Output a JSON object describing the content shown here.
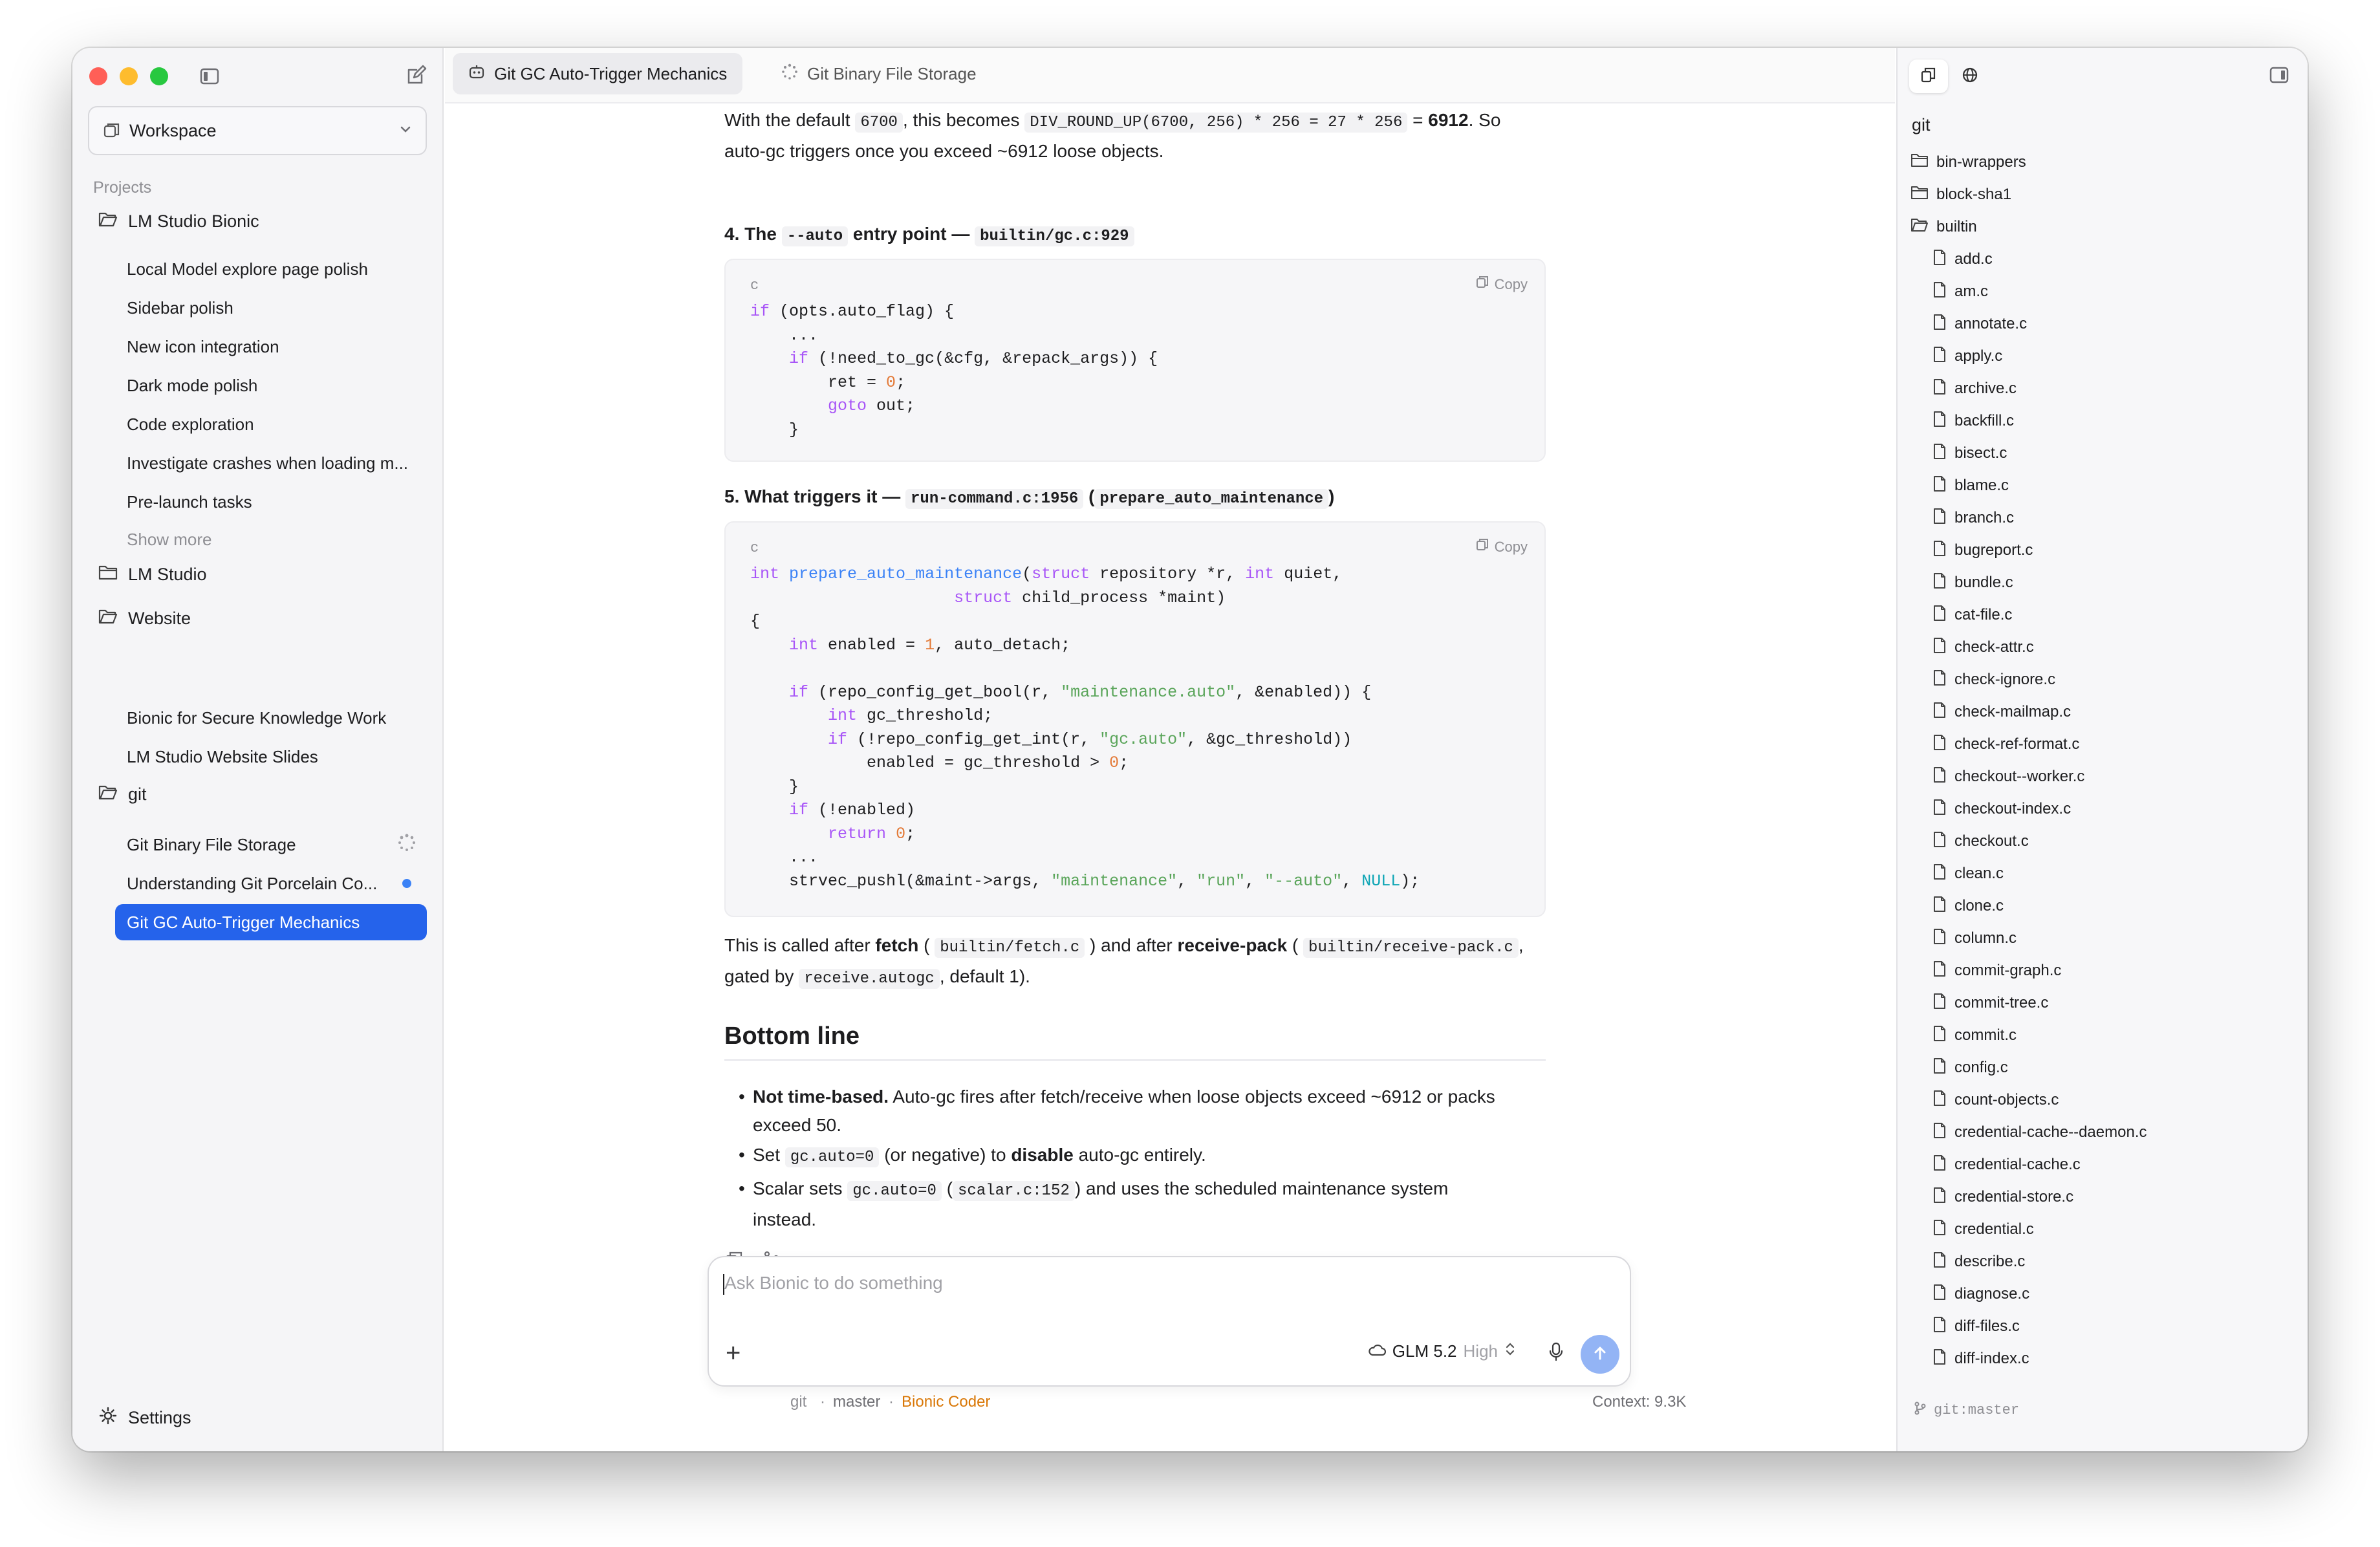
{
  "sidebar": {
    "workspace": "Workspace",
    "projects_label": "Projects",
    "projects": [
      {
        "name": "LM Studio Bionic",
        "items": [
          "Local Model explore page polish",
          "Sidebar polish",
          "New icon integration",
          "Dark mode polish",
          "Code exploration",
          "Investigate crashes when loading m...",
          "Pre-launch tasks"
        ],
        "show_more": "Show more"
      },
      {
        "name": "LM Studio",
        "items": []
      },
      {
        "name": "Website",
        "items": [
          "Bionic for Secure Knowledge Work",
          "LM Studio Website Slides"
        ]
      },
      {
        "name": "git",
        "items": [
          "Git Binary File Storage",
          "Understanding Git Porcelain Co...",
          "Git GC Auto-Trigger Mechanics"
        ]
      }
    ],
    "settings": "Settings"
  },
  "tabs": [
    {
      "label": "Git GC Auto-Trigger Mechanics",
      "active": true
    },
    {
      "label": "Git Binary File Storage",
      "active": false
    }
  ],
  "content": {
    "p1": {
      "a": "With the default",
      "c1": "6700",
      "b": ", this becomes",
      "c2": "DIV_ROUND_UP(6700, 256) * 256 = 27 * 256",
      "c": "=",
      "d": "6912",
      "e": ". So",
      "line2": "auto-gc triggers once you exceed ~6912 loose objects."
    },
    "h4a": {
      "a": "4. The",
      "code": "--auto",
      "b": "entry point —",
      "code2": "builtin/gc.c:929"
    },
    "code1": {
      "lang": "c",
      "copy": "Copy"
    },
    "h4b": {
      "a": "5. What triggers it —",
      "code": "run-command.c:1956",
      "b": "(",
      "code2": "prepare_auto_maintenance",
      "c": ")"
    },
    "code2": {
      "lang": "c",
      "copy": "Copy"
    },
    "p2": {
      "a": "This is called after",
      "b1": "fetch",
      "c1": "(",
      "code1": "builtin/fetch.c",
      "d1": ") and after",
      "b2": "receive-pack",
      "c2": "(",
      "code2": "builtin/receive-pack.c",
      "d2": ",",
      "line2a": "gated by",
      "code3": "receive.autogc",
      "line2b": ", default 1)."
    },
    "h2": "Bottom line",
    "bullets": [
      {
        "bold": "Not time-based.",
        "text": "Auto-gc fires after fetch/receive when loose objects exceed ~6912 or packs",
        "text2": "exceed 50."
      },
      {
        "a": "Set",
        "code": "gc.auto=0",
        "b": "(or negative) to",
        "bold": "disable",
        "c": "auto-gc entirely."
      },
      {
        "a": "Scalar sets",
        "code": "gc.auto=0",
        "b": "(",
        "code2": "scalar.c:152",
        "c": ") and uses the scheduled maintenance system",
        "line2": "instead."
      }
    ]
  },
  "composer": {
    "placeholder": "Ask Bionic to do something",
    "model": "GLM 5.2",
    "effort": "High"
  },
  "status": {
    "repo": "git",
    "branch": "master",
    "agent": "Bionic Coder",
    "context": "Context: 9.3K",
    "sep": "·"
  },
  "files": {
    "root": "git",
    "folders": [
      "bin-wrappers",
      "block-sha1",
      "builtin"
    ],
    "items": [
      "add.c",
      "am.c",
      "annotate.c",
      "apply.c",
      "archive.c",
      "backfill.c",
      "bisect.c",
      "blame.c",
      "branch.c",
      "bugreport.c",
      "bundle.c",
      "cat-file.c",
      "check-attr.c",
      "check-ignore.c",
      "check-mailmap.c",
      "check-ref-format.c",
      "checkout--worker.c",
      "checkout-index.c",
      "checkout.c",
      "clean.c",
      "clone.c",
      "column.c",
      "commit-graph.c",
      "commit-tree.c",
      "commit.c",
      "config.c",
      "count-objects.c",
      "credential-cache--daemon.c",
      "credential-cache.c",
      "credential-store.c",
      "credential.c",
      "describe.c",
      "diagnose.c",
      "diff-files.c",
      "diff-index.c"
    ],
    "branch": "git:master"
  },
  "colors": {
    "accent": "#2563eb",
    "agent": "#d97706",
    "send": "#93b4f5"
  }
}
